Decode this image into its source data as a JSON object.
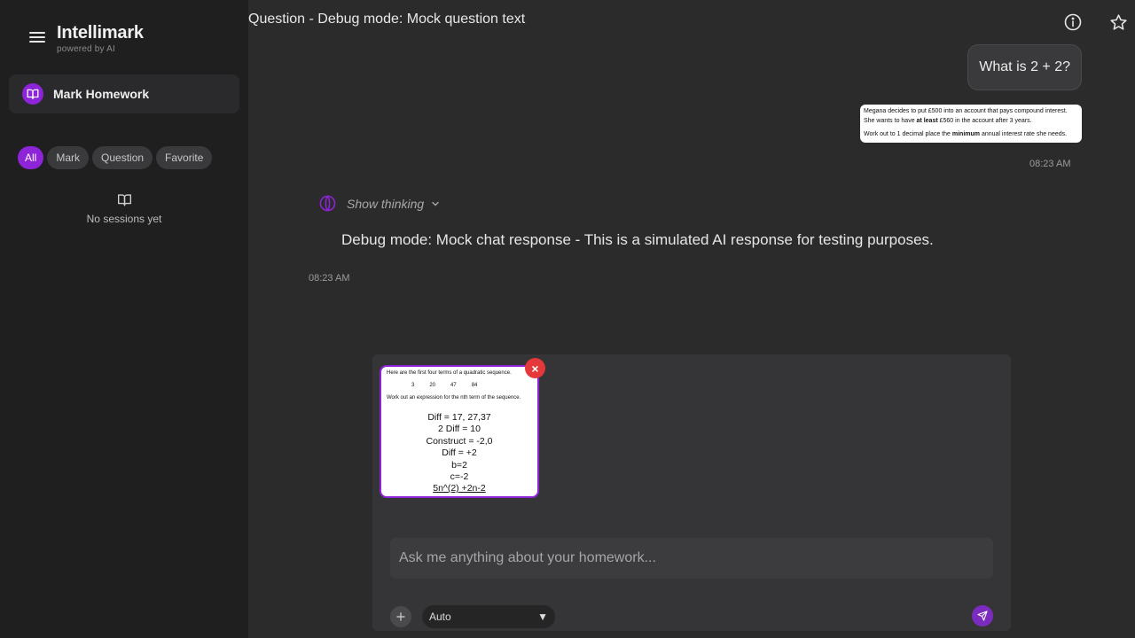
{
  "app": {
    "name": "Intellimark",
    "tagline": "powered by AI"
  },
  "sidebar": {
    "primary_action": "Mark Homework",
    "filters": [
      "All",
      "Mark",
      "Question",
      "Favorite"
    ],
    "active_filter": "All",
    "empty_state": "No sessions yet"
  },
  "header": {
    "title": "Question - Debug mode: Mock question text"
  },
  "chat": {
    "user_message": "What is 2 + 2?",
    "question_image": {
      "line1": "Megana decides to put £500 into an account that pays compound interest.",
      "line2_a": "She wants to have ",
      "line2_b": "at least",
      "line2_c": " £560 in the account after 3 years.",
      "line3_a": "Work out to 1 decimal place the ",
      "line3_b": "minimum",
      "line3_c": " annual interest rate she needs."
    },
    "user_time": "08:23 AM",
    "thinking_label": "Show thinking",
    "ai_response": "Debug mode: Mock chat response - This is a simulated AI response for testing purposes.",
    "ai_time": "08:23 AM"
  },
  "composer": {
    "attachment": {
      "header": "Here are the first four terms of a quadratic sequence.",
      "terms": [
        "3",
        "20",
        "47",
        "84"
      ],
      "instruction": "Work out an expression for the nth term of the sequence.",
      "work": [
        "Diff = 17, 27,37",
        "2 Diff = 10",
        "Construct = -2,0",
        "Diff = +2",
        "b=2",
        "c=-2",
        "5n^(2) +2n-2"
      ]
    },
    "remove_label": "×",
    "placeholder": "Ask me anything about your homework...",
    "value": "",
    "mode": "Auto"
  },
  "colors": {
    "accent": "#8e24d8",
    "remove": "#e5383b",
    "background": "#2b2b2c",
    "sidebar": "#1f1f20"
  },
  "icons": {
    "menu": "hamburger-icon",
    "book": "open-book-icon",
    "info": "info-icon",
    "star": "star-icon",
    "thinking": "brain-icon",
    "send": "paper-plane-icon"
  }
}
